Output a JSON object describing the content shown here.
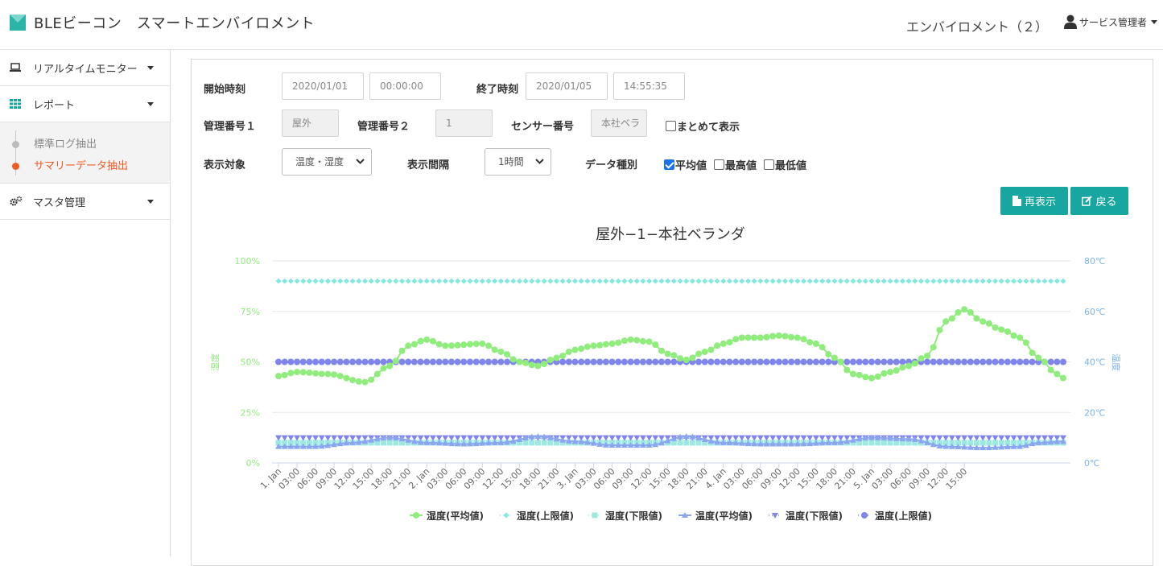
{
  "header": {
    "app_title": "BLEビーコン　スマートエンバイロメント",
    "environment": "エンバイロメント（２）",
    "user": "サービス管理者"
  },
  "sidebar": {
    "items": [
      {
        "label": "リアルタイムモニター",
        "icon": "laptop-icon"
      },
      {
        "label": "レポート",
        "icon": "grid-icon"
      },
      {
        "label": "マスタ管理",
        "icon": "gears-icon"
      }
    ],
    "report_sub": [
      {
        "label": "標準ログ抽出",
        "active": false
      },
      {
        "label": "サマリーデータ抽出",
        "active": true
      }
    ]
  },
  "form": {
    "start_label": "開始時刻",
    "start_date": "2020/01/01",
    "start_time": "00:00:00",
    "end_label": "終了時刻",
    "end_date": "2020/01/05",
    "end_time": "14:55:35",
    "mgmt1_label": "管理番号１",
    "mgmt1_value": "屋外",
    "mgmt2_label": "管理番号２",
    "mgmt2_value": "1",
    "sensor_label": "センサー番号",
    "sensor_value": "本社ベラ",
    "combine_label": "まとめて表示",
    "target_label": "表示対象",
    "target_value": "温度・湿度",
    "interval_label": "表示間隔",
    "interval_value": "1時間",
    "datatype_label": "データ種別",
    "dt_avg": "平均値",
    "dt_max": "最高値",
    "dt_min": "最低値",
    "refresh_label": "再表示",
    "back_label": "戻る"
  },
  "colors": {
    "accent": "#17a6a0",
    "active_orange": "#f05a24",
    "humidity_green": "#90ed7d",
    "temp_blue": "#7cb5ec",
    "series_purple": "#8085e9",
    "cyan": "#84e8e0"
  },
  "chart_data": {
    "type": "line",
    "title": "屋外−1−本社ベランダ",
    "y_left": {
      "label": "湿度",
      "ticks": [
        "0%",
        "25%",
        "50%",
        "75%",
        "100%"
      ],
      "min": 0,
      "max": 100
    },
    "y_right": {
      "label": "温度",
      "ticks": [
        "0℃",
        "20℃",
        "40℃",
        "60℃",
        "80℃"
      ],
      "min": 0,
      "max": 80
    },
    "x_ticks": [
      "1. Jan",
      "03:00",
      "06:00",
      "09:00",
      "12:00",
      "15:00",
      "18:00",
      "21:00",
      "2. Jan",
      "03:00",
      "06:00",
      "09:00",
      "12:00",
      "15:00",
      "18:00",
      "21:00",
      "3. Jan",
      "03:00",
      "06:00",
      "09:00",
      "12:00",
      "15:00",
      "18:00",
      "21:00",
      "4. Jan",
      "03:00",
      "06:00",
      "09:00",
      "12:00",
      "15:00",
      "18:00",
      "21:00",
      "5. Jan",
      "03:00",
      "06:00",
      "09:00",
      "12:00",
      "15:00"
    ],
    "legend_position": "bottom",
    "grid": true,
    "series": [
      {
        "name": "湿度(平均値)",
        "axis": "left",
        "marker": "circle",
        "color": "#90ed7d",
        "line": true,
        "keyframes": [
          [
            0,
            43
          ],
          [
            3,
            45
          ],
          [
            8,
            44
          ],
          [
            14,
            40
          ],
          [
            18,
            48
          ],
          [
            21,
            58
          ],
          [
            24,
            61
          ],
          [
            27,
            58
          ],
          [
            33,
            59
          ],
          [
            36,
            55
          ],
          [
            39,
            50
          ],
          [
            42,
            48
          ],
          [
            45,
            52
          ],
          [
            48,
            56
          ],
          [
            51,
            58
          ],
          [
            54,
            59
          ],
          [
            57,
            61
          ],
          [
            60,
            60
          ],
          [
            63,
            54
          ],
          [
            66,
            51
          ],
          [
            69,
            55
          ],
          [
            72,
            59
          ],
          [
            75,
            62
          ],
          [
            78,
            62
          ],
          [
            81,
            63
          ],
          [
            84,
            62
          ],
          [
            87,
            59
          ],
          [
            90,
            52
          ],
          [
            93,
            44
          ],
          [
            96,
            42
          ],
          [
            99,
            45
          ],
          [
            102,
            48
          ],
          [
            105,
            53
          ],
          [
            108,
            70
          ],
          [
            111,
            76
          ],
          [
            114,
            70
          ],
          [
            117,
            66
          ],
          [
            120,
            62
          ],
          [
            123,
            52
          ],
          [
            126,
            44
          ],
          [
            127,
            42
          ]
        ]
      },
      {
        "name": "湿度(上限値)",
        "axis": "left",
        "marker": "diamond",
        "color": "#84e8e0",
        "line": false,
        "constant": 90
      },
      {
        "name": "湿度(下限値)",
        "axis": "left",
        "marker": "square",
        "color": "#9de8e0",
        "line": false,
        "constant": 10
      },
      {
        "name": "温度(平均値)",
        "axis": "right",
        "marker": "triangle",
        "color": "#8aa6f0",
        "line": true,
        "keyframes": [
          [
            0,
            6.5
          ],
          [
            6,
            6.5
          ],
          [
            12,
            8
          ],
          [
            18,
            10
          ],
          [
            24,
            8
          ],
          [
            30,
            7.5
          ],
          [
            36,
            8
          ],
          [
            42,
            10.5
          ],
          [
            48,
            8.5
          ],
          [
            54,
            7
          ],
          [
            60,
            7
          ],
          [
            66,
            10.5
          ],
          [
            72,
            8
          ],
          [
            78,
            7.5
          ],
          [
            84,
            7.5
          ],
          [
            90,
            8
          ],
          [
            96,
            10
          ],
          [
            102,
            9.5
          ],
          [
            108,
            6.5
          ],
          [
            114,
            6
          ],
          [
            120,
            6.5
          ],
          [
            123,
            8
          ],
          [
            127,
            8.5
          ]
        ]
      },
      {
        "name": "温度(下限値)",
        "axis": "right",
        "marker": "triangle-down",
        "color": "#8085e9",
        "line": false,
        "constant": 10
      },
      {
        "name": "温度(上限値)",
        "axis": "right",
        "marker": "circle",
        "color": "#8085e9",
        "line": false,
        "constant": 40
      }
    ]
  }
}
